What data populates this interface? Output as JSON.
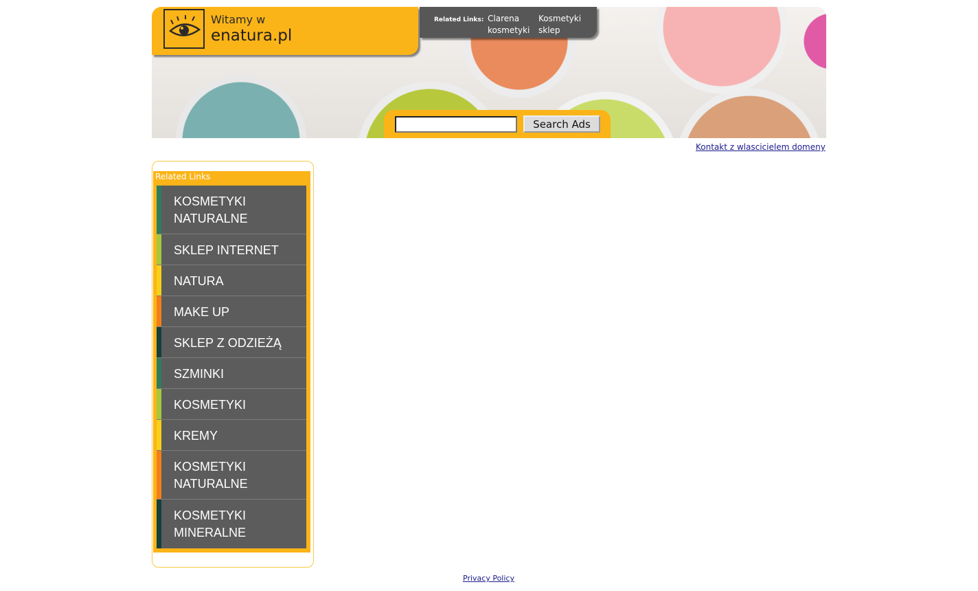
{
  "header": {
    "welcome": "Witamy w",
    "domain": "enatura.pl",
    "related_title": "Related Links:",
    "related_links": [
      "Clarena kosmetyki",
      "Kosmetyki sklep"
    ],
    "search_button": "Search Ads",
    "search_value": ""
  },
  "contact_link": "Kontakt z wlascicielem domeny",
  "sidebar": {
    "title": "Related Links",
    "items": [
      {
        "label": "KOSMETYKI NATURALNE",
        "color": "#2e7d5e"
      },
      {
        "label": "SKLEP INTERNET",
        "color": "#a8c83c"
      },
      {
        "label": "NATURA",
        "color": "#f7d01a"
      },
      {
        "label": "MAKE UP",
        "color": "#f57f17"
      },
      {
        "label": "SKLEP Z ODZIEŻĄ",
        "color": "#123f3f"
      },
      {
        "label": "SZMINKI",
        "color": "#2e7d5e"
      },
      {
        "label": "KOSMETYKI",
        "color": "#a8c83c"
      },
      {
        "label": "KREMY",
        "color": "#f7d01a"
      },
      {
        "label": "KOSMETYKI NATURALNE",
        "color": "#f57f17"
      },
      {
        "label": "KOSMETYKI MINERALNE",
        "color": "#123f3f"
      }
    ]
  },
  "footer": {
    "privacy": "Privacy Policy"
  }
}
